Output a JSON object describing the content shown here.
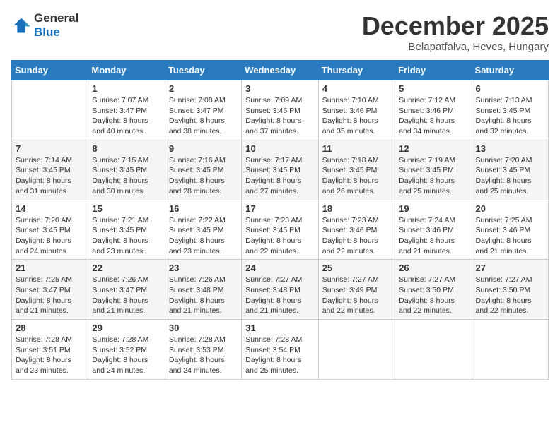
{
  "logo": {
    "general": "General",
    "blue": "Blue"
  },
  "title": "December 2025",
  "subtitle": "Belapatfalva, Heves, Hungary",
  "days_of_week": [
    "Sunday",
    "Monday",
    "Tuesday",
    "Wednesday",
    "Thursday",
    "Friday",
    "Saturday"
  ],
  "weeks": [
    [
      {
        "day": "",
        "sunrise": "",
        "sunset": "",
        "daylight": ""
      },
      {
        "day": "1",
        "sunrise": "Sunrise: 7:07 AM",
        "sunset": "Sunset: 3:47 PM",
        "daylight": "Daylight: 8 hours and 40 minutes."
      },
      {
        "day": "2",
        "sunrise": "Sunrise: 7:08 AM",
        "sunset": "Sunset: 3:47 PM",
        "daylight": "Daylight: 8 hours and 38 minutes."
      },
      {
        "day": "3",
        "sunrise": "Sunrise: 7:09 AM",
        "sunset": "Sunset: 3:46 PM",
        "daylight": "Daylight: 8 hours and 37 minutes."
      },
      {
        "day": "4",
        "sunrise": "Sunrise: 7:10 AM",
        "sunset": "Sunset: 3:46 PM",
        "daylight": "Daylight: 8 hours and 35 minutes."
      },
      {
        "day": "5",
        "sunrise": "Sunrise: 7:12 AM",
        "sunset": "Sunset: 3:46 PM",
        "daylight": "Daylight: 8 hours and 34 minutes."
      },
      {
        "day": "6",
        "sunrise": "Sunrise: 7:13 AM",
        "sunset": "Sunset: 3:45 PM",
        "daylight": "Daylight: 8 hours and 32 minutes."
      }
    ],
    [
      {
        "day": "7",
        "sunrise": "Sunrise: 7:14 AM",
        "sunset": "Sunset: 3:45 PM",
        "daylight": "Daylight: 8 hours and 31 minutes."
      },
      {
        "day": "8",
        "sunrise": "Sunrise: 7:15 AM",
        "sunset": "Sunset: 3:45 PM",
        "daylight": "Daylight: 8 hours and 30 minutes."
      },
      {
        "day": "9",
        "sunrise": "Sunrise: 7:16 AM",
        "sunset": "Sunset: 3:45 PM",
        "daylight": "Daylight: 8 hours and 28 minutes."
      },
      {
        "day": "10",
        "sunrise": "Sunrise: 7:17 AM",
        "sunset": "Sunset: 3:45 PM",
        "daylight": "Daylight: 8 hours and 27 minutes."
      },
      {
        "day": "11",
        "sunrise": "Sunrise: 7:18 AM",
        "sunset": "Sunset: 3:45 PM",
        "daylight": "Daylight: 8 hours and 26 minutes."
      },
      {
        "day": "12",
        "sunrise": "Sunrise: 7:19 AM",
        "sunset": "Sunset: 3:45 PM",
        "daylight": "Daylight: 8 hours and 25 minutes."
      },
      {
        "day": "13",
        "sunrise": "Sunrise: 7:20 AM",
        "sunset": "Sunset: 3:45 PM",
        "daylight": "Daylight: 8 hours and 25 minutes."
      }
    ],
    [
      {
        "day": "14",
        "sunrise": "Sunrise: 7:20 AM",
        "sunset": "Sunset: 3:45 PM",
        "daylight": "Daylight: 8 hours and 24 minutes."
      },
      {
        "day": "15",
        "sunrise": "Sunrise: 7:21 AM",
        "sunset": "Sunset: 3:45 PM",
        "daylight": "Daylight: 8 hours and 23 minutes."
      },
      {
        "day": "16",
        "sunrise": "Sunrise: 7:22 AM",
        "sunset": "Sunset: 3:45 PM",
        "daylight": "Daylight: 8 hours and 23 minutes."
      },
      {
        "day": "17",
        "sunrise": "Sunrise: 7:23 AM",
        "sunset": "Sunset: 3:45 PM",
        "daylight": "Daylight: 8 hours and 22 minutes."
      },
      {
        "day": "18",
        "sunrise": "Sunrise: 7:23 AM",
        "sunset": "Sunset: 3:46 PM",
        "daylight": "Daylight: 8 hours and 22 minutes."
      },
      {
        "day": "19",
        "sunrise": "Sunrise: 7:24 AM",
        "sunset": "Sunset: 3:46 PM",
        "daylight": "Daylight: 8 hours and 21 minutes."
      },
      {
        "day": "20",
        "sunrise": "Sunrise: 7:25 AM",
        "sunset": "Sunset: 3:46 PM",
        "daylight": "Daylight: 8 hours and 21 minutes."
      }
    ],
    [
      {
        "day": "21",
        "sunrise": "Sunrise: 7:25 AM",
        "sunset": "Sunset: 3:47 PM",
        "daylight": "Daylight: 8 hours and 21 minutes."
      },
      {
        "day": "22",
        "sunrise": "Sunrise: 7:26 AM",
        "sunset": "Sunset: 3:47 PM",
        "daylight": "Daylight: 8 hours and 21 minutes."
      },
      {
        "day": "23",
        "sunrise": "Sunrise: 7:26 AM",
        "sunset": "Sunset: 3:48 PM",
        "daylight": "Daylight: 8 hours and 21 minutes."
      },
      {
        "day": "24",
        "sunrise": "Sunrise: 7:27 AM",
        "sunset": "Sunset: 3:48 PM",
        "daylight": "Daylight: 8 hours and 21 minutes."
      },
      {
        "day": "25",
        "sunrise": "Sunrise: 7:27 AM",
        "sunset": "Sunset: 3:49 PM",
        "daylight": "Daylight: 8 hours and 22 minutes."
      },
      {
        "day": "26",
        "sunrise": "Sunrise: 7:27 AM",
        "sunset": "Sunset: 3:50 PM",
        "daylight": "Daylight: 8 hours and 22 minutes."
      },
      {
        "day": "27",
        "sunrise": "Sunrise: 7:27 AM",
        "sunset": "Sunset: 3:50 PM",
        "daylight": "Daylight: 8 hours and 22 minutes."
      }
    ],
    [
      {
        "day": "28",
        "sunrise": "Sunrise: 7:28 AM",
        "sunset": "Sunset: 3:51 PM",
        "daylight": "Daylight: 8 hours and 23 minutes."
      },
      {
        "day": "29",
        "sunrise": "Sunrise: 7:28 AM",
        "sunset": "Sunset: 3:52 PM",
        "daylight": "Daylight: 8 hours and 24 minutes."
      },
      {
        "day": "30",
        "sunrise": "Sunrise: 7:28 AM",
        "sunset": "Sunset: 3:53 PM",
        "daylight": "Daylight: 8 hours and 24 minutes."
      },
      {
        "day": "31",
        "sunrise": "Sunrise: 7:28 AM",
        "sunset": "Sunset: 3:54 PM",
        "daylight": "Daylight: 8 hours and 25 minutes."
      },
      {
        "day": "",
        "sunrise": "",
        "sunset": "",
        "daylight": ""
      },
      {
        "day": "",
        "sunrise": "",
        "sunset": "",
        "daylight": ""
      },
      {
        "day": "",
        "sunrise": "",
        "sunset": "",
        "daylight": ""
      }
    ]
  ]
}
